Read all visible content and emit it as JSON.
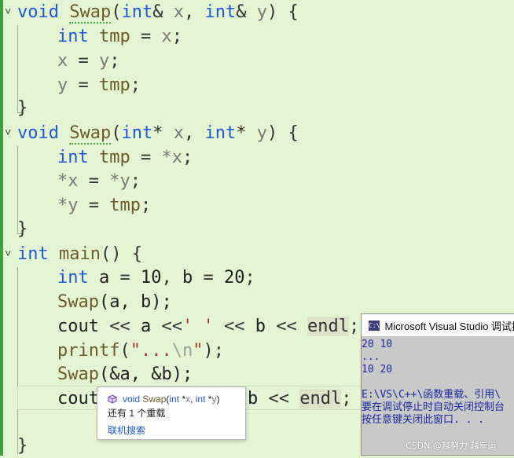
{
  "code": {
    "lines": [
      {
        "fold": "˅",
        "kw1": "void",
        "fn": "Swap",
        "p1": "(",
        "kw2": "int",
        "op1": "&",
        "v1": "x",
        "sep": ",",
        "kw3": "int",
        "op2": "&",
        "v2": "y",
        "p2": ")",
        "brace": "{"
      },
      {
        "kw": "int",
        "name": "tmp",
        "op": "=",
        "val": "x",
        "end": ";"
      },
      {
        "lhs": "x",
        "op": "=",
        "rhs": "y",
        "end": ";"
      },
      {
        "lhs": "y",
        "op": "=",
        "rhs": "tmp",
        "end": ";"
      },
      {
        "brace": "}"
      },
      {
        "fold": "˅",
        "kw1": "void",
        "fn": "Swap",
        "p1": "(",
        "kw2": "int",
        "op1": "*",
        "v1": "x",
        "sep": ",",
        "kw3": "int",
        "op2": "*",
        "v2": "y",
        "p2": ")",
        "brace": "{"
      },
      {
        "kw": "int",
        "name": "tmp",
        "op": "=",
        "val": "*x",
        "end": ";"
      },
      {
        "lhs": "*x",
        "op": "=",
        "rhs": "*y",
        "end": ";"
      },
      {
        "lhs": "*y",
        "op": "=",
        "rhs": "tmp",
        "end": ";"
      },
      {
        "brace": "}"
      },
      {
        "fold": "˅",
        "kw": "int",
        "fn": "main",
        "parens": "()",
        "brace": "{"
      },
      {
        "kw": "int",
        "a": "a",
        "eq1": "=",
        "n1": "10",
        "c": ",",
        "b": "b",
        "eq2": "=",
        "n2": "20",
        "end": ";"
      },
      {
        "fn": "Swap",
        "args": "(a, b);"
      },
      {
        "cout": "cout",
        "op1": "<<",
        "a": "a",
        "op2": "<<",
        "str": "' '",
        "op3": "<<",
        "b": "b",
        "op4": "<<",
        "endl": "endl",
        "end": ";"
      },
      {
        "fn": "printf",
        "p1": "(",
        "s1": "\"...",
        "esc": "\\n",
        "s2": "\"",
        "p2": ");"
      },
      {
        "fn": "Swap",
        "args": "(&a, &b);"
      },
      {
        "cout": "cout",
        "tail1": "b",
        "op": "<<",
        "endl": "endl",
        "end": ";"
      },
      {
        "brace": "}"
      }
    ]
  },
  "console": {
    "title": "Microsoft Visual Studio 调试控制台",
    "icon_label": "C:\\",
    "lines": [
      "20 10",
      "...",
      "10 20",
      "",
      "E:\\VS\\C++\\函数重载、引用\\",
      "要在调试停止时自动关闭控制台",
      "按任意键关闭此窗口. . ."
    ]
  },
  "tooltip": {
    "sig_void": "void",
    "sig_fn": "Swap",
    "sig_open": "(",
    "sig_int1": "int",
    "sig_star1": " *",
    "sig_x": "x",
    "sig_comma": ", ",
    "sig_int2": "int",
    "sig_star2": " *",
    "sig_y": "y",
    "sig_close": ")",
    "overloads": "还有 1 个重载",
    "search_link": "联机搜索"
  },
  "watermark": "CSDN @越努力 越幸运",
  "colors": {
    "background": "#e4f5d4",
    "keyword": "#1f58d8",
    "function": "#6b5a2a",
    "string": "#b0382a",
    "change_bar": "#3f9f3f"
  }
}
